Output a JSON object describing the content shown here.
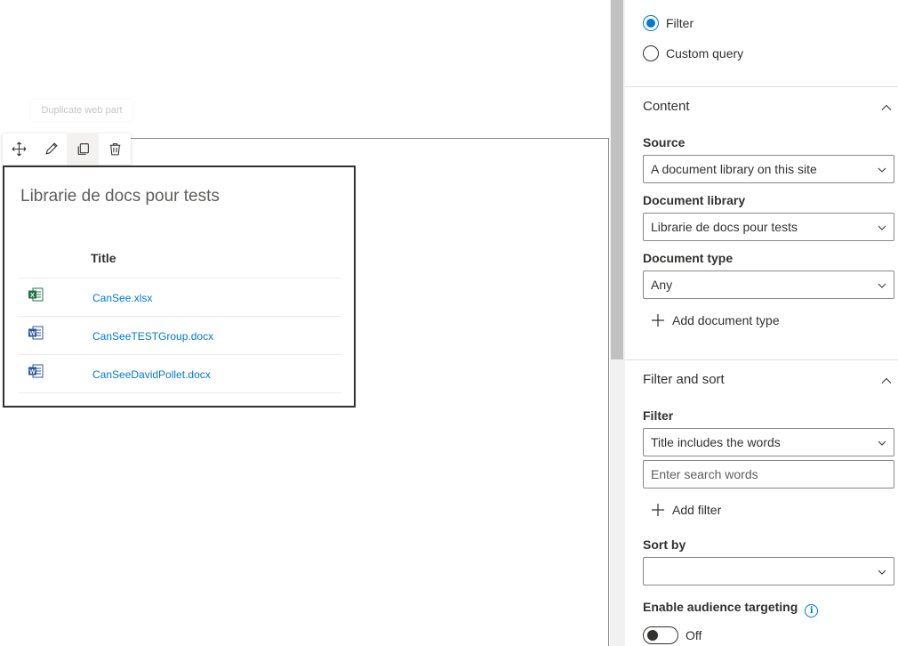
{
  "canvas": {
    "tooltip": "Duplicate web part",
    "toolbar": {
      "move": "move-icon",
      "edit": "pencil-icon",
      "duplicate": "copy-icon",
      "delete": "trash-icon"
    },
    "webpart": {
      "title": "Librarie de docs pour tests",
      "column_header": "Title",
      "files": [
        {
          "name": "CanSee.xlsx",
          "icon": "excel-icon"
        },
        {
          "name": "CanSeeTESTGroup.docx",
          "icon": "word-icon"
        },
        {
          "name": "CanSeeDavidPollet.docx",
          "icon": "word-icon"
        }
      ]
    }
  },
  "pane": {
    "mode_options": [
      {
        "label": "Filter",
        "selected": true
      },
      {
        "label": "Custom query",
        "selected": false
      }
    ],
    "content": {
      "header": "Content",
      "source_label": "Source",
      "source_value": "A document library on this site",
      "library_label": "Document library",
      "library_value": "Librarie de docs pour tests",
      "doctype_label": "Document type",
      "doctype_value": "Any",
      "add_doctype": "Add document type"
    },
    "filter_sort": {
      "header": "Filter and sort",
      "filter_label": "Filter",
      "filter_value": "Title includes the words",
      "search_placeholder": "Enter search words",
      "add_filter": "Add filter",
      "sortby_label": "Sort by",
      "sortby_value": "",
      "audience_label": "Enable audience targeting",
      "toggle_text": "Off"
    }
  },
  "colors": {
    "accent": "#0078d4",
    "excel": "#217346",
    "word": "#2b579a"
  }
}
